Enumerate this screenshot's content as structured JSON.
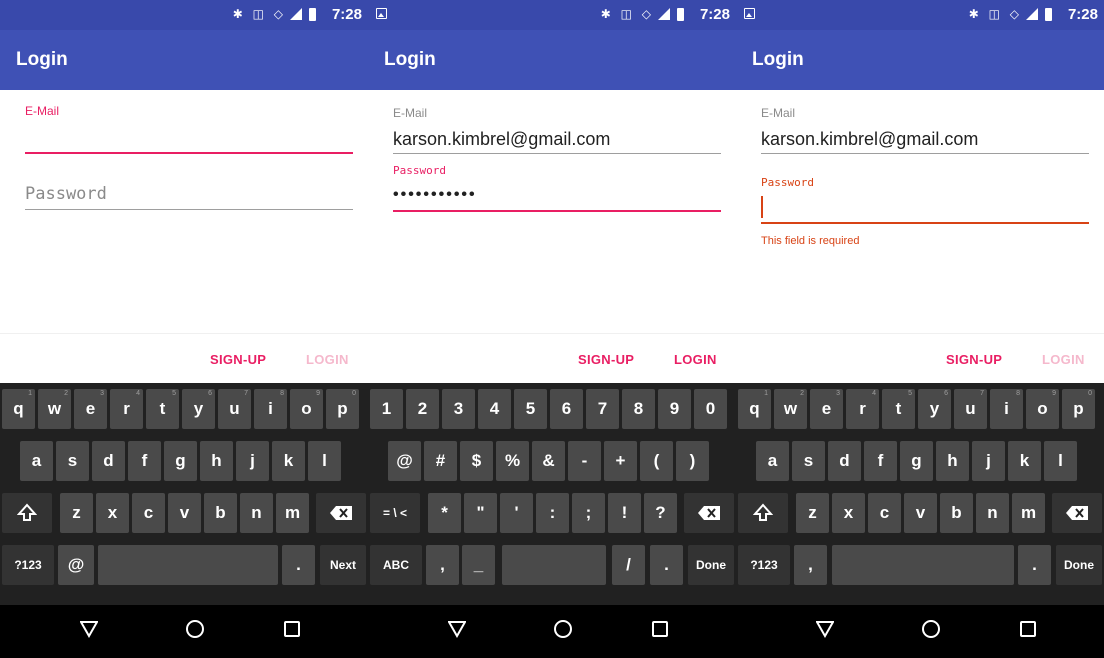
{
  "status": {
    "time": "7:28",
    "icons": "✱ ◫ ◇"
  },
  "screens": [
    {
      "title": "Login",
      "email_label": "E-Mail",
      "password_placeholder": "Password",
      "signup": "SIGN-UP",
      "login": "LOGIN",
      "keyboard": "letters",
      "next_key": "Next"
    },
    {
      "title": "Login",
      "email_label": "E-Mail",
      "email_value": "karson.kimbrel@gmail.com",
      "password_label": "Password",
      "password_value": "•••••••••••",
      "signup": "SIGN-UP",
      "login": "LOGIN",
      "keyboard": "symbols",
      "done_key": "Done"
    },
    {
      "title": "Login",
      "email_label": "E-Mail",
      "email_value": "karson.kimbrel@gmail.com",
      "password_label": "Password",
      "error": "This field is required",
      "signup": "SIGN-UP",
      "login": "LOGIN",
      "keyboard": "letters",
      "done_key": "Done"
    }
  ],
  "keys": {
    "row1_letters": [
      "q",
      "w",
      "e",
      "r",
      "t",
      "y",
      "u",
      "i",
      "o",
      "p"
    ],
    "row1_hints": [
      "1",
      "2",
      "3",
      "4",
      "5",
      "6",
      "7",
      "8",
      "9",
      "0"
    ],
    "row2_letters": [
      "a",
      "s",
      "d",
      "f",
      "g",
      "h",
      "j",
      "k",
      "l"
    ],
    "row3_letters": [
      "z",
      "x",
      "c",
      "v",
      "b",
      "n",
      "m"
    ],
    "mode_key": "?123",
    "at_key": "@",
    "comma_key": ",",
    "period_key": ".",
    "row1_digits": [
      "1",
      "2",
      "3",
      "4",
      "5",
      "6",
      "7",
      "8",
      "9",
      "0"
    ],
    "row2_symbols": [
      "@",
      "#",
      "$",
      "%",
      "&",
      "-",
      "+",
      "(",
      ")"
    ],
    "row3_symbols": [
      "*",
      "\"",
      "'",
      ":",
      ";",
      "!",
      "?"
    ],
    "sym_shift_key": "= \\ <",
    "abc_key": "ABC",
    "underscore_key": "_",
    "slash_key": "/"
  },
  "colors": {
    "primary": "#3f51b5",
    "status": "#3949ab",
    "accent": "#e91e63",
    "error": "#d84315"
  }
}
